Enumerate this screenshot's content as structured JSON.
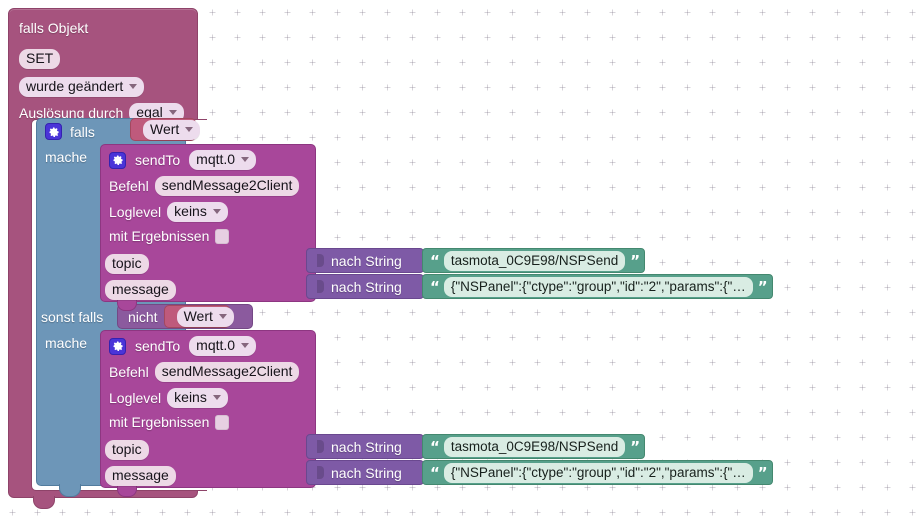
{
  "canvas": {
    "background_color": "#ffffff",
    "grid_color": "#bcb4c4",
    "grid_spacing_px": 25
  },
  "colors": {
    "hat_block": "#a6537e",
    "control_block": "#6d96b8",
    "value_block": "#bf5a7c",
    "not_block": "#8b5a9e",
    "sendto_block": "#a8479a",
    "tostring_block": "#7e5aa6",
    "string_block": "#57a08b",
    "gear_icon": "#4a34d8"
  },
  "trigger_block": {
    "title": "falls Objekt",
    "object_id": "SET",
    "event": "wurde geändert",
    "trigger_by_label": "Auslösung durch",
    "trigger_by_value": "egal"
  },
  "control_block": {
    "if_label": "falls",
    "do_label": "mache",
    "elseif_label": "sonst falls",
    "do_label_2": "mache"
  },
  "conditions": {
    "first": {
      "value": "Wert"
    },
    "second": {
      "not_label": "nicht",
      "value": "Wert"
    }
  },
  "sendto_blocks": [
    {
      "title": "sendTo",
      "instance": "mqtt.0",
      "command_label": "Befehl",
      "command_value": "sendMessage2Client",
      "loglevel_label": "Loglevel",
      "loglevel_value": "keins",
      "with_results_label": "mit Ergebnissen",
      "with_results_checked": false,
      "topic_label": "topic",
      "message_label": "message",
      "topic_convert": "nach String",
      "message_convert": "nach String",
      "topic_value": "tasmota_0C9E98/NSPSend",
      "message_value": "{\"NSPanel\":{\"ctype\":\"group\",\"id\":\"2\",\"params\":{\"…"
    },
    {
      "title": "sendTo",
      "instance": "mqtt.0",
      "command_label": "Befehl",
      "command_value": "sendMessage2Client",
      "loglevel_label": "Loglevel",
      "loglevel_value": "keins",
      "with_results_label": "mit Ergebnissen",
      "with_results_checked": false,
      "topic_label": "topic",
      "message_label": "message",
      "topic_convert": "nach String",
      "message_convert": "nach String",
      "topic_value": "tasmota_0C9E98/NSPSend",
      "message_value": "{\"NSPanel\":{\"ctype\":\"group\",\"id\":\"2\",\"params\":{\"…"
    }
  ],
  "icons": {
    "gear": "gear-icon",
    "dropdown_caret": "chevron-down-icon",
    "quote_open": "quote-open-icon",
    "quote_close": "quote-close-icon",
    "checkbox": "checkbox-icon"
  }
}
